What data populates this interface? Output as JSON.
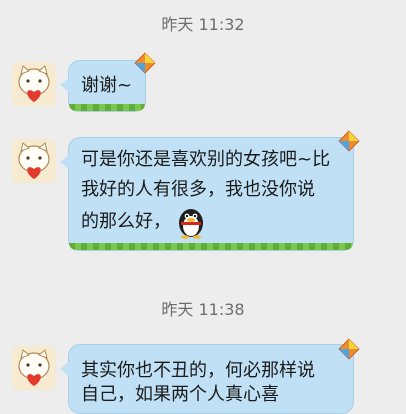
{
  "messages": [
    {
      "timestamp": "昨天 11:32",
      "text": "谢谢~"
    },
    {
      "text_line1": "可是你还是喜欢别的女孩吧~比",
      "text_line2": "我好的人有很多，我也没你说",
      "text_line3": "的那么好，",
      "emoji": "penguin-emoji"
    },
    {
      "timestamp": "昨天 11:38",
      "text_line1": "其实你也不丑的，何必那样说",
      "text_line2": "自己，如果两个人真心喜"
    }
  ],
  "icons": {
    "avatar": "cat-with-heart-avatar",
    "decoration": "kite-icon"
  },
  "colors": {
    "bubble": "#bfe0f5",
    "grass": "#5fae3a",
    "background": "#ededed"
  }
}
